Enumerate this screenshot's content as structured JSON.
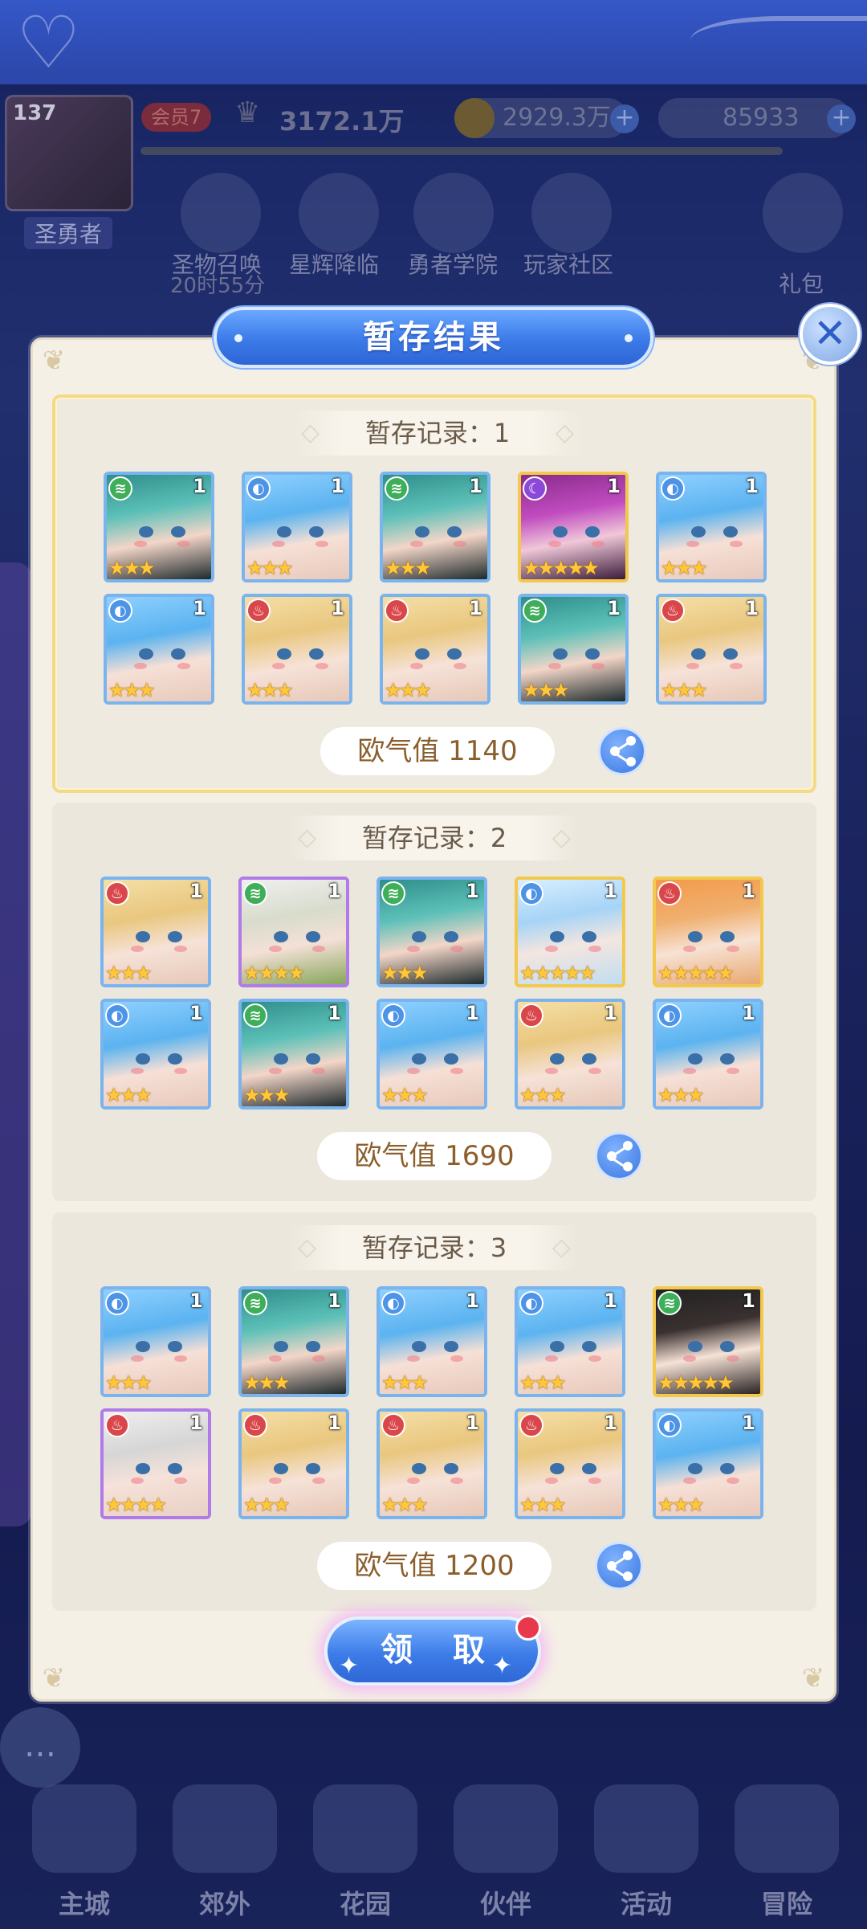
{
  "hud": {
    "level": "137",
    "player_name": "圣勇者",
    "vip": "会员7",
    "power": "3172.1万",
    "gold": "2929.3万",
    "gems": "85933",
    "menu": [
      "圣物召唤",
      "星辉降临",
      "勇者学院",
      "玩家社区",
      "礼包"
    ],
    "timer": "20时55分",
    "bottom_nav": [
      "主城",
      "郊外",
      "花园",
      "伙伴",
      "活动",
      "冒险"
    ]
  },
  "modal": {
    "title": "暂存结果",
    "close_icon": "close-icon",
    "claim_label": "领 取",
    "records": [
      {
        "title": "暂存记录：1",
        "luck": "欧气值 1140",
        "cards": [
          {
            "hair": "teal",
            "element": "wind",
            "count": "1",
            "stars": 3,
            "rarity": 3
          },
          {
            "hair": "blue",
            "element": "water",
            "count": "1",
            "stars": 3,
            "rarity": 3
          },
          {
            "hair": "teal",
            "element": "wind",
            "count": "1",
            "stars": 3,
            "rarity": 3
          },
          {
            "hair": "purple",
            "element": "dark",
            "count": "1",
            "stars": 5,
            "rarity": 5
          },
          {
            "hair": "blue",
            "element": "water",
            "count": "1",
            "stars": 3,
            "rarity": 3
          },
          {
            "hair": "blue",
            "element": "water",
            "count": "1",
            "stars": 3,
            "rarity": 3
          },
          {
            "hair": "blonde",
            "element": "fire",
            "count": "1",
            "stars": 3,
            "rarity": 3
          },
          {
            "hair": "blonde",
            "element": "fire",
            "count": "1",
            "stars": 3,
            "rarity": 3
          },
          {
            "hair": "teal",
            "element": "wind",
            "count": "1",
            "stars": 3,
            "rarity": 3
          },
          {
            "hair": "blonde",
            "element": "fire",
            "count": "1",
            "stars": 3,
            "rarity": 3
          }
        ]
      },
      {
        "title": "暂存记录：2",
        "luck": "欧气值 1690",
        "cards": [
          {
            "hair": "blonde",
            "element": "fire",
            "count": "1",
            "stars": 3,
            "rarity": 3
          },
          {
            "hair": "white",
            "element": "wind",
            "count": "1",
            "stars": 4,
            "rarity": 4
          },
          {
            "hair": "teal",
            "element": "wind",
            "count": "1",
            "stars": 3,
            "rarity": 3
          },
          {
            "hair": "silver-blue",
            "element": "water",
            "count": "1",
            "stars": 5,
            "rarity": 5
          },
          {
            "hair": "orange",
            "element": "fire",
            "count": "1",
            "stars": 5,
            "rarity": 5
          },
          {
            "hair": "blue",
            "element": "water",
            "count": "1",
            "stars": 3,
            "rarity": 3
          },
          {
            "hair": "teal",
            "element": "wind",
            "count": "1",
            "stars": 3,
            "rarity": 3
          },
          {
            "hair": "blue",
            "element": "water",
            "count": "1",
            "stars": 3,
            "rarity": 3
          },
          {
            "hair": "blonde",
            "element": "fire",
            "count": "1",
            "stars": 3,
            "rarity": 3
          },
          {
            "hair": "blue",
            "element": "water",
            "count": "1",
            "stars": 3,
            "rarity": 3
          }
        ]
      },
      {
        "title": "暂存记录：3",
        "luck": "欧气值 1200",
        "cards": [
          {
            "hair": "blue",
            "element": "water",
            "count": "1",
            "stars": 3,
            "rarity": 3
          },
          {
            "hair": "teal",
            "element": "wind",
            "count": "1",
            "stars": 3,
            "rarity": 3
          },
          {
            "hair": "blue",
            "element": "water",
            "count": "1",
            "stars": 3,
            "rarity": 3
          },
          {
            "hair": "blue",
            "element": "water",
            "count": "1",
            "stars": 3,
            "rarity": 3
          },
          {
            "hair": "black",
            "element": "wind",
            "count": "1",
            "stars": 5,
            "rarity": 5
          },
          {
            "hair": "white2",
            "element": "fire",
            "count": "1",
            "stars": 4,
            "rarity": 4
          },
          {
            "hair": "blonde",
            "element": "fire",
            "count": "1",
            "stars": 3,
            "rarity": 3
          },
          {
            "hair": "blonde",
            "element": "fire",
            "count": "1",
            "stars": 3,
            "rarity": 3
          },
          {
            "hair": "blonde",
            "element": "fire",
            "count": "1",
            "stars": 3,
            "rarity": 3
          },
          {
            "hair": "blue",
            "element": "water",
            "count": "1",
            "stars": 3,
            "rarity": 3
          }
        ]
      }
    ]
  }
}
